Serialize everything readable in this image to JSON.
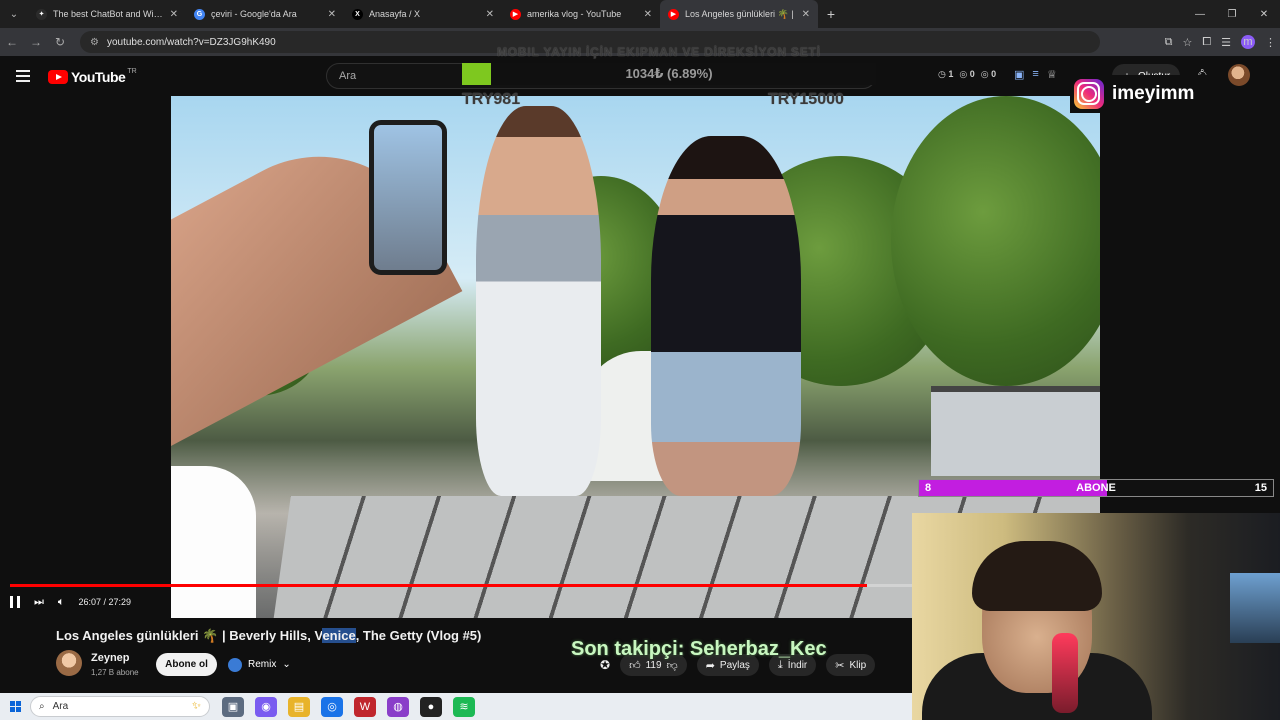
{
  "browser": {
    "tabs": [
      {
        "title": "The best ChatBot and Widgets",
        "color": "#2b2b2b",
        "glyph": "✦"
      },
      {
        "title": "çeviri - Google'da Ara",
        "color": "#4285f4",
        "glyph": "G"
      },
      {
        "title": "Anasayfa / X",
        "color": "#000000",
        "glyph": "X"
      },
      {
        "title": "amerika vlog - YouTube",
        "color": "#ff0000",
        "glyph": "▶"
      },
      {
        "title": "Los Angeles günlükleri 🌴 | ",
        "color": "#ff0000",
        "glyph": "▶"
      }
    ],
    "active_tab": 4,
    "url": "youtube.com/watch?v=DZ3JG9hK490"
  },
  "youtube": {
    "region": "TR",
    "logo_text": "YouTube",
    "search_placeholder": "Ara",
    "create_label": "Oluştur",
    "counters": [
      "1",
      "0",
      "0"
    ]
  },
  "overlays": {
    "donation_title": "MOBIL YAYIN İÇİN EKIPMAN VE DİREKSİYON SETİ",
    "goal_progress_text": "1034₺ (6.89%)",
    "goal_fraction": 0.0689,
    "goal_min": "TRY981",
    "goal_max": "TRY15000",
    "instagram_handle": "imeyimm",
    "sub_current": "8",
    "sub_label": "ABONE",
    "sub_max": "15",
    "sub_fraction": 0.53,
    "last_follower": "Son takipçi: Seherbaz_Kec"
  },
  "video": {
    "time_display": "26:07 / 27:29",
    "progress_fraction": 0.95,
    "title_before": "Los Angeles günlükleri 🌴 | Beverly Hills, V",
    "title_highlight": "enice",
    "title_after": ", The Getty (Vlog #5)",
    "channel_name": "Zeynep",
    "channel_subs": "1,27 B abone",
    "subscribe_label": "Abone ol",
    "remix_label": "Remix",
    "like_count": "119",
    "share_label": "Paylaş",
    "download_label": "İndir",
    "clip_label": "Klip"
  },
  "taskbar": {
    "search_label": "Ara",
    "apps": [
      {
        "name": "task-view",
        "color": "#5c6b80",
        "glyph": "▣"
      },
      {
        "name": "copilot",
        "color": "#7a5cf0",
        "glyph": "◉"
      },
      {
        "name": "file-explorer",
        "color": "#e8b32a",
        "glyph": "▤"
      },
      {
        "name": "chrome",
        "color": "#1a73e8",
        "glyph": "◎"
      },
      {
        "name": "winrar",
        "color": "#c0262d",
        "glyph": "W"
      },
      {
        "name": "obs",
        "color": "#8a3ec9",
        "glyph": "◍"
      },
      {
        "name": "app-dark",
        "color": "#222222",
        "glyph": "●"
      },
      {
        "name": "spotify",
        "color": "#1db954",
        "glyph": "≋"
      }
    ]
  }
}
